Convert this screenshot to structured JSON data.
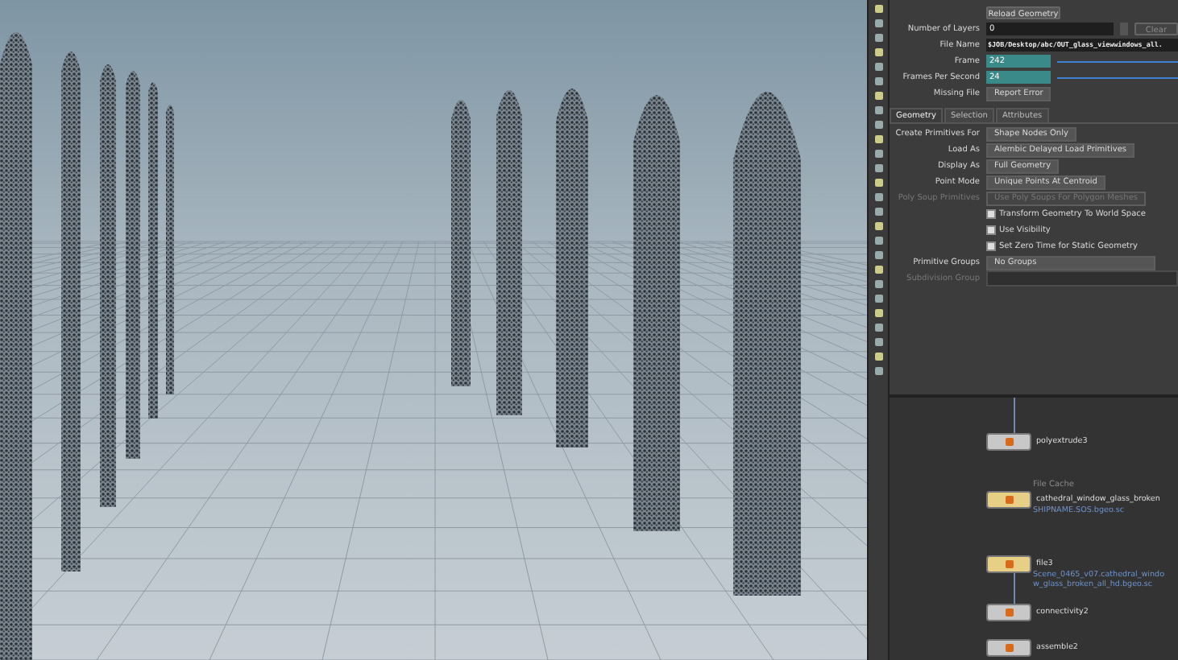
{
  "parameters": {
    "reload_button": "Reload Geometry",
    "fields": [
      {
        "label": "Number of Layers",
        "value": "0",
        "kind": "spinner",
        "button": "Clear"
      },
      {
        "label": "File Name",
        "value": "$JOB/Desktop/abc/OUT_glass_viewwindows_all.",
        "kind": "text"
      },
      {
        "label": "Frame",
        "value": "242",
        "kind": "slider"
      },
      {
        "label": "Frames Per Second",
        "value": "24",
        "kind": "slider"
      },
      {
        "label": "Missing File",
        "value": "Report Error",
        "kind": "menu"
      }
    ],
    "tabs": [
      {
        "label": "Geometry",
        "selected": true
      },
      {
        "label": "Selection",
        "selected": false
      },
      {
        "label": "Attributes",
        "selected": false
      }
    ],
    "options": [
      {
        "label": "Create Primitives For",
        "value": "Shape Nodes Only",
        "kind": "menu",
        "disabled": false
      },
      {
        "label": "Load As",
        "value": "Alembic Delayed Load Primitives",
        "kind": "menu",
        "disabled": false
      },
      {
        "label": "Display As",
        "value": "Full Geometry",
        "kind": "menu",
        "disabled": false
      },
      {
        "label": "Point Mode",
        "value": "Unique Points At Centroid",
        "kind": "menu",
        "disabled": false
      },
      {
        "label": "Poly Soup Primitives",
        "value": "Use Poly Soups For Polygon Meshes",
        "kind": "menu",
        "disabled": true
      },
      {
        "label": "Transform Geometry To World Space",
        "kind": "checkbox",
        "checked": true,
        "disabled": false
      },
      {
        "label": "Use Visibility",
        "kind": "checkbox",
        "checked": true,
        "disabled": false
      },
      {
        "label": "Set Zero Time for Static Geometry",
        "kind": "checkbox",
        "checked": true,
        "disabled": false
      },
      {
        "label": "Primitive Groups",
        "value": "No Groups",
        "kind": "wide-menu",
        "disabled": false
      },
      {
        "label": "Subdivision Group",
        "kind": "field",
        "disabled": true
      }
    ]
  },
  "network": {
    "nodes": [
      {
        "name": "polyextrude3",
        "color": "#c8c8c8"
      },
      {
        "type_label": "File Cache",
        "name": "cathedral_window_glass_broken",
        "note": "SHIPNAME.SOS.bgeo.sc",
        "color": "#e8cf86"
      },
      {
        "name": "file3",
        "note": "Scene_0465_v07.cathedral_window_glass_broken_all_hd.bgeo.sc",
        "color": "#e8cf86"
      },
      {
        "name": "connectivity2",
        "color": "#c8c8c8"
      },
      {
        "name": "assemble2",
        "color": "#c8c8c8"
      }
    ]
  }
}
